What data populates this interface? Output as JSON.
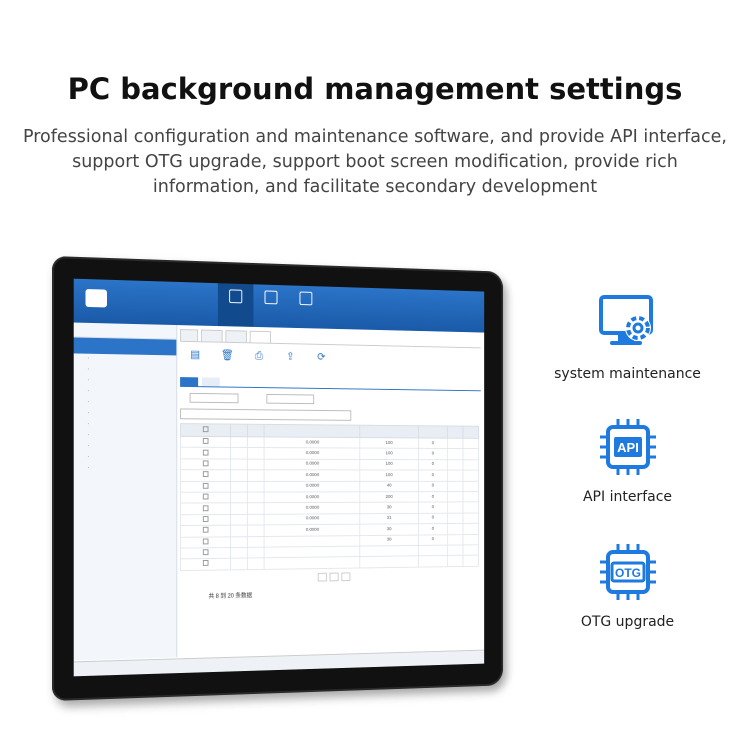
{
  "header": {
    "title": "PC background management settings",
    "subtitle": "Professional configuration and maintenance software, and provide API interface, support OTG upgrade, support boot screen modification, provide rich information, and facilitate secondary development"
  },
  "features": [
    {
      "label": "system maintenance",
      "icon": "monitor-gear-icon"
    },
    {
      "label": "API interface",
      "icon": "api-chip-icon"
    },
    {
      "label": "OTG upgrade",
      "icon": "otg-chip-icon"
    }
  ],
  "colors": {
    "accent": "#1f7ae0",
    "bezel": "#111111",
    "app_header": "#2b74c8"
  },
  "screen": {
    "table_rows": [
      {
        "c3": "0.0000",
        "c4": "100",
        "c5": "0"
      },
      {
        "c3": "0.0000",
        "c4": "100",
        "c5": "0"
      },
      {
        "c3": "0.0000",
        "c4": "100",
        "c5": "0"
      },
      {
        "c3": "0.0000",
        "c4": "100",
        "c5": "0"
      },
      {
        "c3": "0.0000",
        "c4": "40",
        "c5": "0"
      },
      {
        "c3": "0.0000",
        "c4": "200",
        "c5": "0"
      },
      {
        "c3": "0.0000",
        "c4": "30",
        "c5": "0"
      },
      {
        "c3": "0.0000",
        "c4": "31",
        "c5": "0"
      },
      {
        "c3": "0.0000",
        "c4": "30",
        "c5": "0"
      },
      {
        "c3": "",
        "c4": "30",
        "c5": "0"
      },
      {
        "c3": "",
        "c4": "",
        "c5": ""
      },
      {
        "c3": "",
        "c4": "",
        "c5": ""
      }
    ],
    "page_info": "共 8 到 20 条数据"
  }
}
